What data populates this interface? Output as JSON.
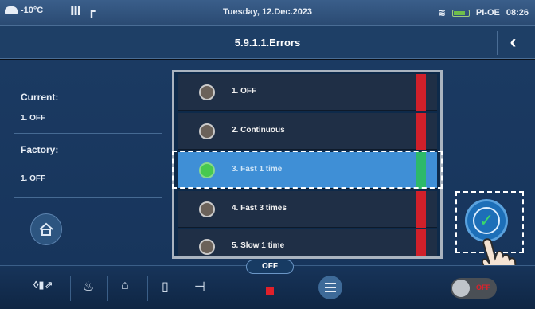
{
  "status": {
    "outdoor_temp": "-10°C",
    "date": "Tuesday, 12.Dec.2023",
    "device": "PI-OE",
    "time": "08:26"
  },
  "header": {
    "title": "5.9.1.1.Errors",
    "back_icon": "chevron-left-icon"
  },
  "info": {
    "current_label": "Current:",
    "current_value": "1. OFF",
    "factory_label": "Factory:",
    "factory_value": "1. OFF"
  },
  "options": [
    {
      "label": "1. OFF",
      "selected": false
    },
    {
      "label": "2. Continuous",
      "selected": false
    },
    {
      "label": "3. Fast 1 time",
      "selected": true
    },
    {
      "label": "4. Fast 3 times",
      "selected": false
    },
    {
      "label": "5. Slow 1 time",
      "selected": false
    }
  ],
  "footer": {
    "mode_badge": "OFF",
    "toggle_label": "OFF"
  },
  "colors": {
    "accent": "#3f8fd6",
    "stripe_red": "#d0202a",
    "stripe_green": "#2db96a",
    "confirm": "#1d6fb8"
  }
}
